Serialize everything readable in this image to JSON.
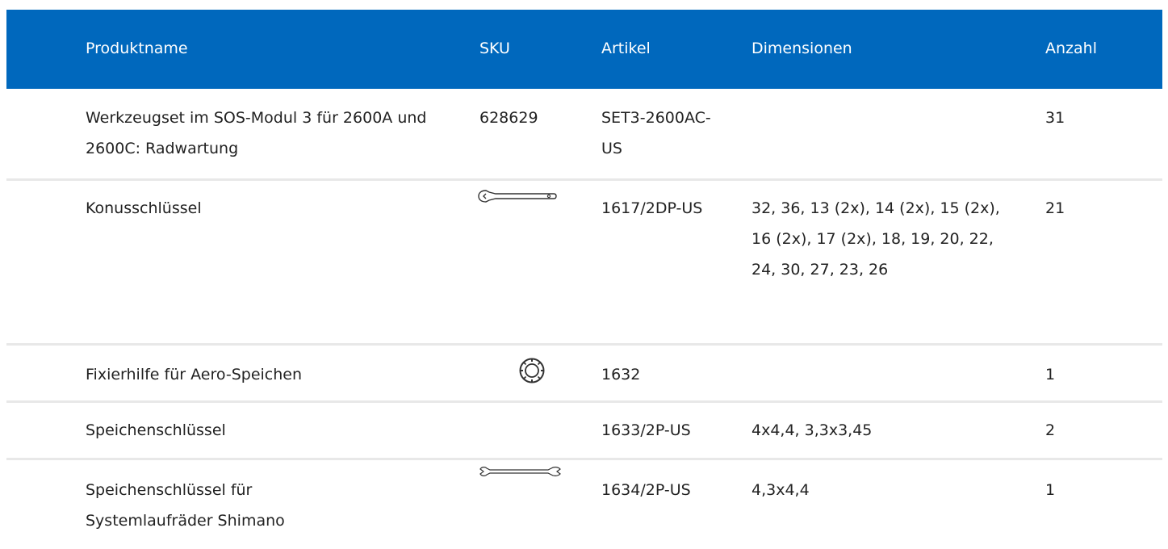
{
  "table": {
    "headers": {
      "name": "Produktname",
      "sku": "SKU",
      "article": "Artikel",
      "dimensions": "Dimensionen",
      "quantity": "Anzahl"
    },
    "rows": [
      {
        "name": "Werkzeugset im SOS-Modul 3 für 2600A und 2600C: Radwartung",
        "sku": "628629",
        "article": "SET3-2600AC-US",
        "dimensions": "",
        "quantity": "31",
        "icon": ""
      },
      {
        "name": "Konusschlüssel",
        "sku": "",
        "article": "1617/2DP-US",
        "dimensions": "32, 36, 13 (2x), 14 (2x), 15 (2x), 16 (2x), 17 (2x), 18, 19, 20, 22, 24, 30, 27, 23, 26",
        "quantity": "21",
        "icon": "cone-wrench-icon"
      },
      {
        "name": "Fixierhilfe für Aero-Speichen",
        "sku": "",
        "article": "1632",
        "dimensions": "",
        "quantity": "1",
        "icon": "aero-spoke-holder-icon"
      },
      {
        "name": "Speichenschlüssel",
        "sku": "",
        "article": "1633/2P-US",
        "dimensions": "4x4,4, 3,3x3,45",
        "quantity": "2",
        "icon": ""
      },
      {
        "name": "Speichenschlüssel für Systemlaufräder Shimano",
        "sku": "",
        "article": "1634/2P-US",
        "dimensions": "4,3x4,4",
        "quantity": "1",
        "icon": "spoke-wrench-icon"
      }
    ]
  },
  "colors": {
    "header_background": "#0068bd",
    "header_text": "#ffffff",
    "row_divider": "#e8e8e8",
    "body_text": "#222222"
  }
}
